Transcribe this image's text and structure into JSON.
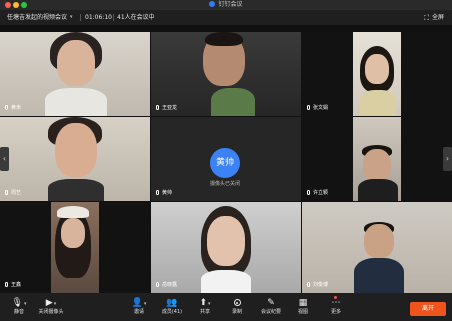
{
  "app": {
    "title": "钉钉会议"
  },
  "meeting": {
    "title": "任塘吉发起的视频会议",
    "duration": "01:06:10",
    "participants_text": "41人在会议中",
    "fullscreen_label": "全屏"
  },
  "participants": [
    {
      "name": "黄米"
    },
    {
      "name": "王亚龙"
    },
    {
      "name": "张文娟"
    },
    {
      "name": "周艺"
    },
    {
      "name": "黄帅",
      "camera_off_text": "摄像头已关闭",
      "avatar_text": "黄帅"
    },
    {
      "name": "许立颖"
    },
    {
      "name": "王鑫"
    },
    {
      "name": "岳晓露"
    },
    {
      "name": "刘俊博"
    }
  ],
  "toolbar": {
    "mute": "静音",
    "camera": "关闭摄像头",
    "invite": "邀请",
    "members": "成员(41)",
    "share": "共享",
    "record": "录制",
    "minutes": "会议纪要",
    "view": "视图",
    "more": "更多",
    "leave": "离开"
  },
  "colors": {
    "accent": "#3b82f6",
    "leave": "#f0531c",
    "background": "#1b1b1b"
  }
}
